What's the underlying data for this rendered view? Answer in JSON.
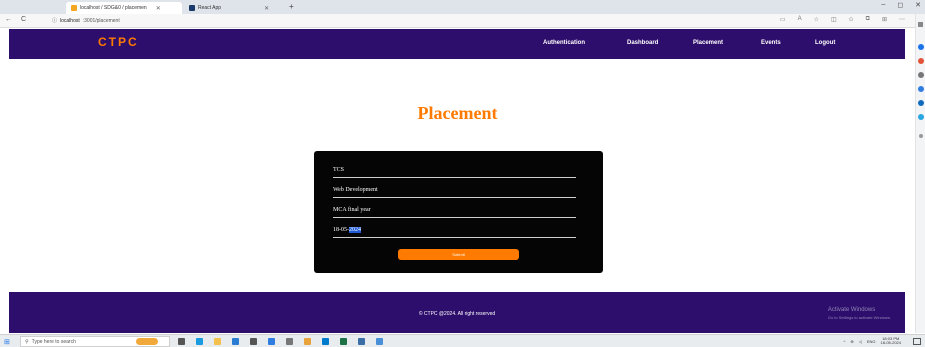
{
  "browser": {
    "tabs": [
      {
        "label": "localhost / SDG&0 / placemen",
        "favicon_color": "#f5a623",
        "active": true
      },
      {
        "label": "React App",
        "favicon_color": "#1a3a6b",
        "active": false
      }
    ],
    "new_tab_label": "+",
    "window_buttons": [
      "–",
      "◻",
      "✕"
    ],
    "nav_icons": [
      "←",
      "C"
    ],
    "address": {
      "host": "localhost",
      "path": ":3001/placement"
    }
  },
  "app": {
    "brand": "CTPC",
    "nav": [
      "Authentication",
      "Dashboard",
      "Placement",
      "Events",
      "Logout"
    ],
    "brand_color": "#ff7a00",
    "navbar_color": "#2e0e6c"
  },
  "page": {
    "title": "Placement",
    "form": {
      "company": "TCS",
      "domain": "Web Development",
      "eligibility": "MCA final year",
      "date_prefix": "18-05-",
      "date_selected": "2024",
      "submit_label": "Submit"
    }
  },
  "footer": {
    "copyright": "© CTPC @2024. All right reserved",
    "watermark_title": "Activate Windows",
    "watermark_sub": "Go to Settings to activate Windows."
  },
  "taskbar": {
    "search_placeholder": "Type here to search",
    "apps": [
      "weather",
      "task-view",
      "edge",
      "file-explorer",
      "mail",
      "store",
      "chrome",
      "settings",
      "vscode",
      "excel",
      "notepad",
      "photos"
    ],
    "clock_time": "18:03 PM",
    "clock_date": "18-05-2024",
    "language": "ENG"
  }
}
